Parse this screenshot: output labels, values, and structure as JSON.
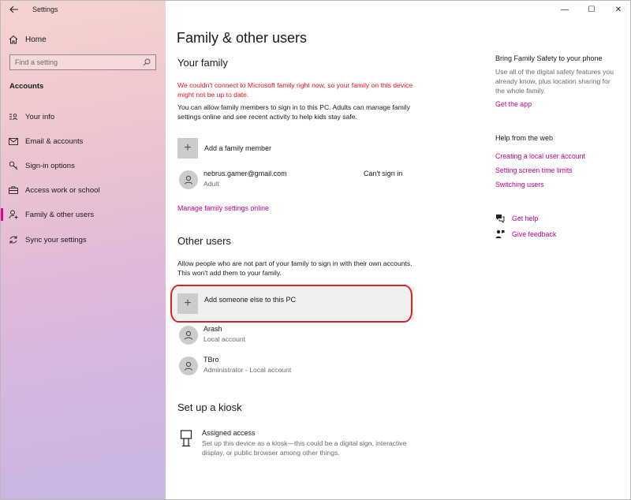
{
  "window": {
    "app_title": "Settings",
    "controls": {
      "minimize": "—",
      "maximize": "☐",
      "close": "✕"
    }
  },
  "sidebar": {
    "home_label": "Home",
    "search_placeholder": "Find a setting",
    "section_heading": "Accounts",
    "items": [
      {
        "label": "Your info",
        "icon": "person-card-icon",
        "active": false
      },
      {
        "label": "Email & accounts",
        "icon": "envelope-icon",
        "active": false
      },
      {
        "label": "Sign-in options",
        "icon": "key-icon",
        "active": false
      },
      {
        "label": "Access work or school",
        "icon": "briefcase-icon",
        "active": false
      },
      {
        "label": "Family & other users",
        "icon": "person-plus-icon",
        "active": true
      },
      {
        "label": "Sync your settings",
        "icon": "sync-icon",
        "active": false
      }
    ],
    "accent_color": "#e3008c"
  },
  "main": {
    "page_title": "Family & other users",
    "your_family": {
      "heading": "Your family",
      "warning": "We couldn't connect to Microsoft family right now, so your family on this device might not be up to date.",
      "description": "You can allow family members to sign in to this PC. Adults can manage family settings online and see recent activity to help kids stay safe.",
      "add_label": "Add a family member",
      "member": {
        "name": "nebrus.gamer@gmail.com",
        "role": "Adult",
        "status": "Can't sign in"
      },
      "manage_link": "Manage family settings online"
    },
    "other_users": {
      "heading": "Other users",
      "description": "Allow people who are not part of your family to sign in with their own accounts. This won't add them to your family.",
      "add_label": "Add someone else to this PC",
      "users": [
        {
          "name": "Arash",
          "type": "Local account"
        },
        {
          "name": "TBro",
          "type": "Administrator - Local account"
        }
      ]
    },
    "kiosk": {
      "heading": "Set up a kiosk",
      "title": "Assigned access",
      "description": "Set up this device as a kiosk—this could be a digital sign, interactive display, or public browser among other things."
    }
  },
  "right_panel": {
    "phone_title": "Bring Family Safety to your phone",
    "phone_text": "Use all of the digital safety features you already know, plus location sharing for the whole family.",
    "get_app_link": "Get the app",
    "help_title": "Help from the web",
    "help_links": [
      "Creating a local user account",
      "Setting screen time limits",
      "Switching users"
    ],
    "get_help": "Get help",
    "give_feedback": "Give feedback",
    "link_color": "#c3008a"
  }
}
